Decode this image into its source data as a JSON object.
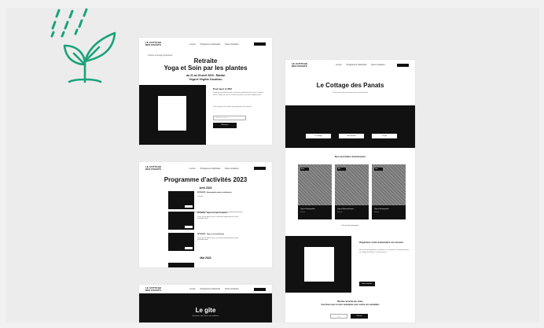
{
  "colors": {
    "accent": "#1aa37a",
    "ink": "#111111",
    "canvas": "#ececec",
    "page": "#f1f1f1"
  },
  "icons": [
    "rain-drops-icon",
    "sprout-icon"
  ],
  "nav": {
    "brand_line1": "LE COTTAGE",
    "brand_line2": "DES PANATS",
    "links": [
      "Le lieu",
      "Programme d'activités",
      "Nous contacter"
    ]
  },
  "board1": {
    "back": "< Retour à la page précédente",
    "title_line1": "Retraite",
    "title_line2": "Yoga et Soin par les plantes",
    "dates": "du 21 au 23 avril 2023 - Mardar",
    "hosts": "Yoga et Virginie Cousinou",
    "side_heading": "Pour quoi et 30H",
    "side_text": "Lorem ipsum dolor sit amet, consectetur adipiscing elit. Donec ut ultrices lectus. Integer dictum, mi at mattis tincidunt, erat metus dapibus urna.",
    "side_text2": "Vous trouverez ici le détail du programme de la retraite.",
    "input_placeholder": "Nombre de places",
    "button": "Réserver"
  },
  "board2": {
    "title": "Programme d'activités 2023",
    "month_april": "Avril 2023",
    "items": [
      {
        "heading": "RETRAITE - Naturopathie plantes médicinales",
        "sub": "Complet"
      },
      {
        "heading": "RETRAITE - Yoga et soin par les plantes",
        "sub": "Lorem ipsum dolor sit amet, consectetur adipiscing elit, sed do eiusmod tempor."
      },
      {
        "heading": "RETRAITE - Yoga et musicothérapie",
        "sub": "Lorem ipsum dolor sit amet, consectetur adipiscing elit, sed do eiusmod tempor."
      }
    ],
    "month_may": "Mai 2023"
  },
  "board3": {
    "title": "Le gîte",
    "sub": "Découvrez notre lieu et son ambiance"
  },
  "board4": {
    "title": "Le Cottage des Panats",
    "intro": "Un lieu pensé pour le ressourcement et le bien-être",
    "hero_buttons": [
      "Le cottage",
      "Nos activités",
      "Le gîte"
    ],
    "events_title": "Nos prochains événements",
    "events": [
      {
        "tag": "Avril",
        "title": "Yoga et Naturopathie",
        "sub": "Retraite"
      },
      {
        "tag": "Mai",
        "title": "Yoga et Musicothérapie",
        "sub": "Retraite"
      },
      {
        "tag": "Juin",
        "title": "Yoga et Naturopathie",
        "sub": "Retraite"
      }
    ],
    "events_link": "Voir tout le programme",
    "org_title": "Organisez votre événement sur mesure",
    "org_text": "Vous souhaitez organiser un séminaire, une retraite ou un événement privé au Cottage des Panats ? Contactez-nous.",
    "org_button": "Nous contacter",
    "newsletter_title": "Restez proche de nous",
    "newsletter_sub": "Inscrivez-vous à notre newsletter pour suivre nos actualités",
    "newsletter_placeholder": "Email",
    "newsletter_button": "S'inscrire"
  }
}
